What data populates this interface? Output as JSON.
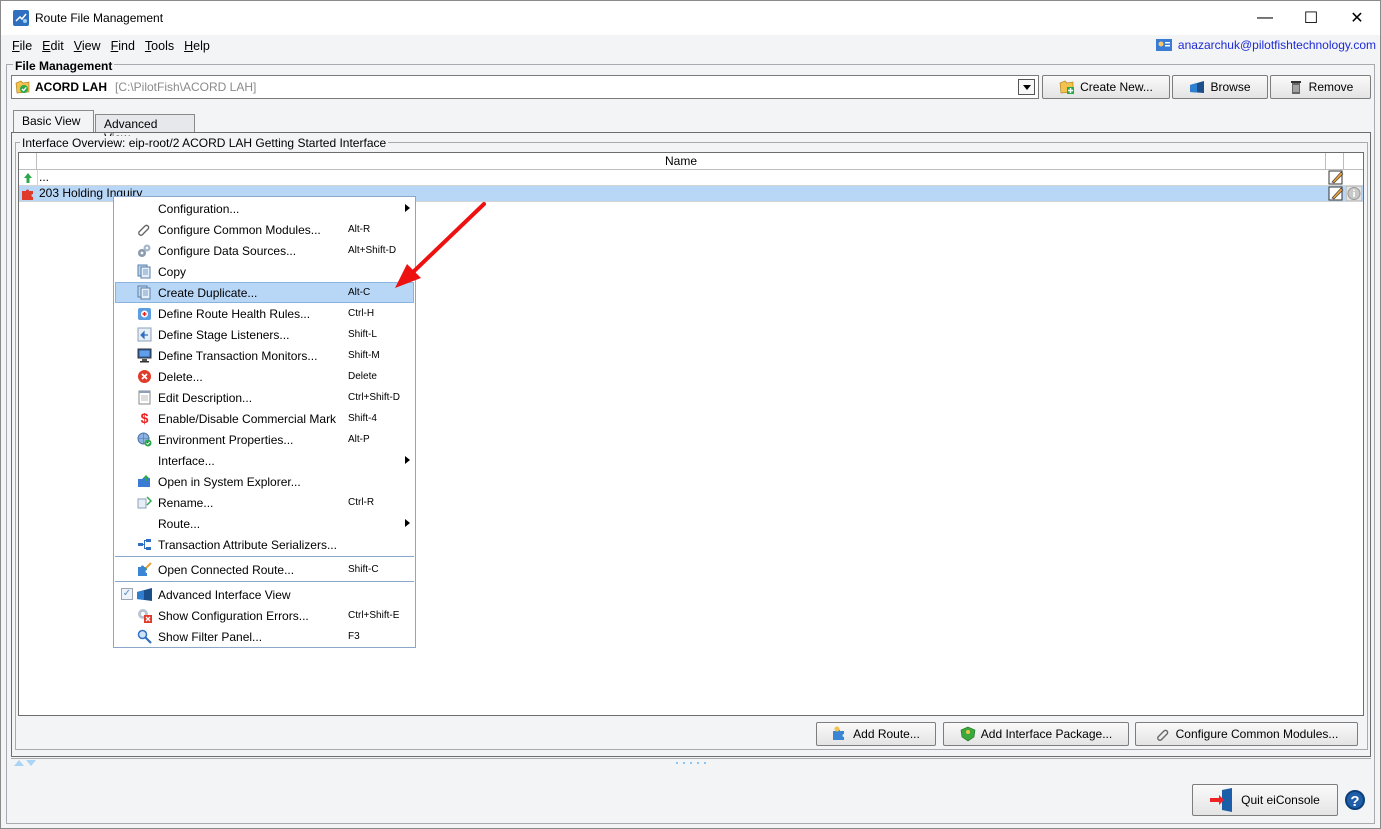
{
  "window": {
    "title": "Route File Management",
    "controls": {
      "minimize": "—",
      "maximize": "☐",
      "close": "✕"
    }
  },
  "menubar": {
    "items": [
      {
        "label": "File",
        "mnemonic": "F"
      },
      {
        "label": "Edit",
        "mnemonic": "E"
      },
      {
        "label": "View",
        "mnemonic": "V"
      },
      {
        "label": "Find",
        "mnemonic": "F"
      },
      {
        "label": "Tools",
        "mnemonic": "T"
      },
      {
        "label": "Help",
        "mnemonic": "H"
      }
    ],
    "user_email": "anazarchuk@pilotfishtechnology.com"
  },
  "file_management": {
    "group_label": "File Management",
    "selected_project": {
      "name": "ACORD LAH",
      "path": "[C:\\PilotFish\\ACORD LAH]"
    },
    "buttons": {
      "create_new": "Create New...",
      "browse": "Browse",
      "remove": "Remove"
    }
  },
  "tabs": [
    {
      "label": "Basic View",
      "active": true
    },
    {
      "label": "Advanced View",
      "active": false
    }
  ],
  "interface_overview": {
    "group_label": "Interface Overview: eip-root/2 ACORD LAH Getting Started Interface",
    "table": {
      "columns": [
        "",
        "Name",
        "",
        ""
      ],
      "rows": [
        {
          "icon": "up-folder-icon",
          "name": "...",
          "selected": false,
          "has_edit": true,
          "has_info": false
        },
        {
          "icon": "route-puzzle-icon",
          "name": "203 Holding Inquiry",
          "selected": true,
          "has_edit": true,
          "has_info": true
        }
      ]
    },
    "buttons": {
      "add_route": "Add Route...",
      "add_interface_package": "Add Interface Package...",
      "configure_common_modules": "Configure Common Modules..."
    }
  },
  "context_menu": {
    "items": [
      {
        "label": "Configuration...",
        "shortcut": "",
        "icon": "",
        "submenu": true
      },
      {
        "label": "Configure Common Modules...",
        "shortcut": "Alt-R",
        "icon": "chain-link-icon"
      },
      {
        "label": "Configure Data Sources...",
        "shortcut": "Alt+Shift-D",
        "icon": "gears-icon"
      },
      {
        "label": "Copy",
        "shortcut": "",
        "icon": "copy-icon"
      },
      {
        "label": "Create Duplicate...",
        "shortcut": "Alt-C",
        "icon": "duplicate-icon",
        "highlighted": true
      },
      {
        "label": "Define Route Health Rules...",
        "shortcut": "Ctrl-H",
        "icon": "health-kit-icon"
      },
      {
        "label": "Define Stage Listeners...",
        "shortcut": "Shift-L",
        "icon": "listener-icon"
      },
      {
        "label": "Define Transaction Monitors...",
        "shortcut": "Shift-M",
        "icon": "monitor-icon"
      },
      {
        "label": "Delete...",
        "shortcut": "Delete",
        "icon": "delete-icon"
      },
      {
        "label": "Edit Description...",
        "shortcut": "Ctrl+Shift-D",
        "icon": "notepad-icon"
      },
      {
        "label": "Enable/Disable Commercial Mark",
        "shortcut": "Shift-4",
        "icon": "dollar-icon"
      },
      {
        "label": "Environment Properties...",
        "shortcut": "Alt-P",
        "icon": "globe-check-icon"
      },
      {
        "label": "Interface...",
        "shortcut": "",
        "icon": "",
        "submenu": true
      },
      {
        "label": "Open in System Explorer...",
        "shortcut": "",
        "icon": "folder-open-icon"
      },
      {
        "label": "Rename...",
        "shortcut": "Ctrl-R",
        "icon": "rename-icon"
      },
      {
        "label": "Route...",
        "shortcut": "",
        "icon": "",
        "submenu": true
      },
      {
        "label": "Transaction Attribute Serializers...",
        "shortcut": "",
        "icon": "serializer-icon"
      },
      {
        "label": "Open Connected Route...",
        "shortcut": "Shift-C",
        "icon": "connected-route-icon"
      },
      {
        "label": "Advanced Interface View",
        "shortcut": "",
        "icon": "advanced-view-icon",
        "checked": true
      },
      {
        "label": "Show Configuration Errors...",
        "shortcut": "Ctrl+Shift-E",
        "icon": "config-error-icon"
      },
      {
        "label": "Show Filter Panel...",
        "shortcut": "F3",
        "icon": "magnifier-icon"
      }
    ]
  },
  "footer": {
    "quit_label": "Quit eiConsole",
    "help_label": "?"
  },
  "colors": {
    "selection": "#b8d7f7",
    "link_blue": "#1d2bd6",
    "annotation_arrow": "#ee1111"
  }
}
